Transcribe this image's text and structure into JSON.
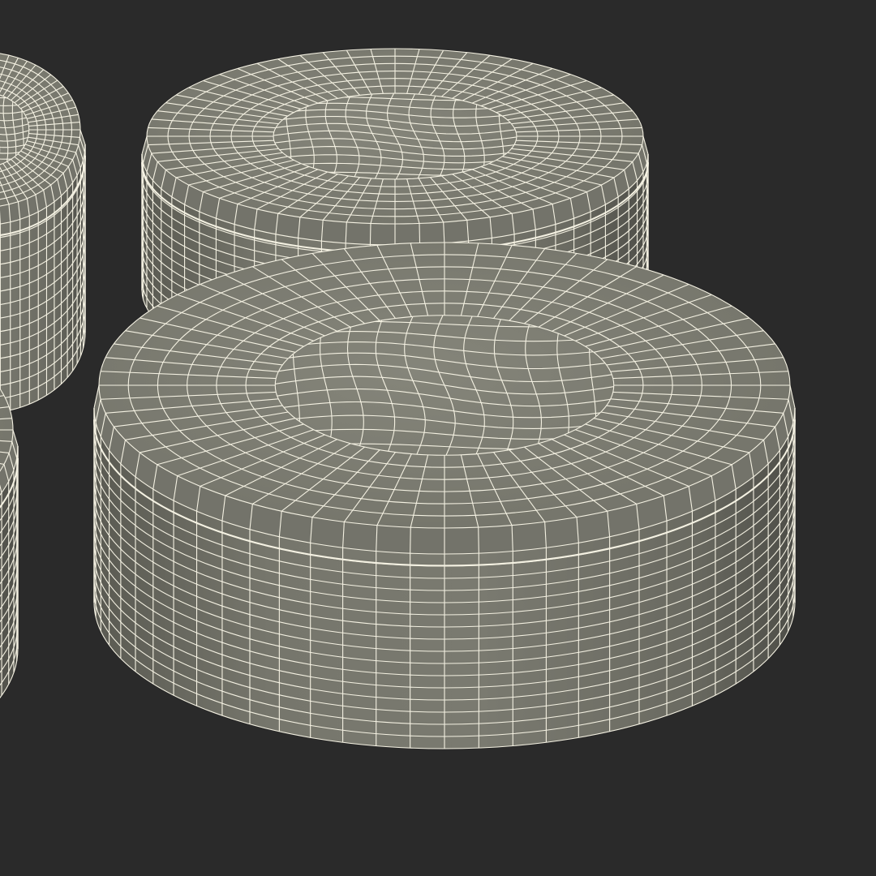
{
  "scene": {
    "background_color": "#2a2a2a",
    "wire_color": "#f4f1e2",
    "side_color": "#73736a",
    "side_shadow_color": "#505049",
    "top_color": "#7c7c72",
    "top_light_color": "#8b8b80",
    "object_count": 4,
    "objects": [
      {
        "name": "puck-front-center",
        "segments": 32,
        "side_rings": 16,
        "top_rings": 7
      },
      {
        "name": "puck-back-center",
        "segments": 32,
        "side_rings": 13,
        "top_rings": 7
      },
      {
        "name": "puck-back-left",
        "segments": 32,
        "side_rings": 14,
        "top_rings": 7
      },
      {
        "name": "puck-front-left",
        "segments": 32,
        "side_rings": 16,
        "top_rings": 7
      }
    ]
  }
}
